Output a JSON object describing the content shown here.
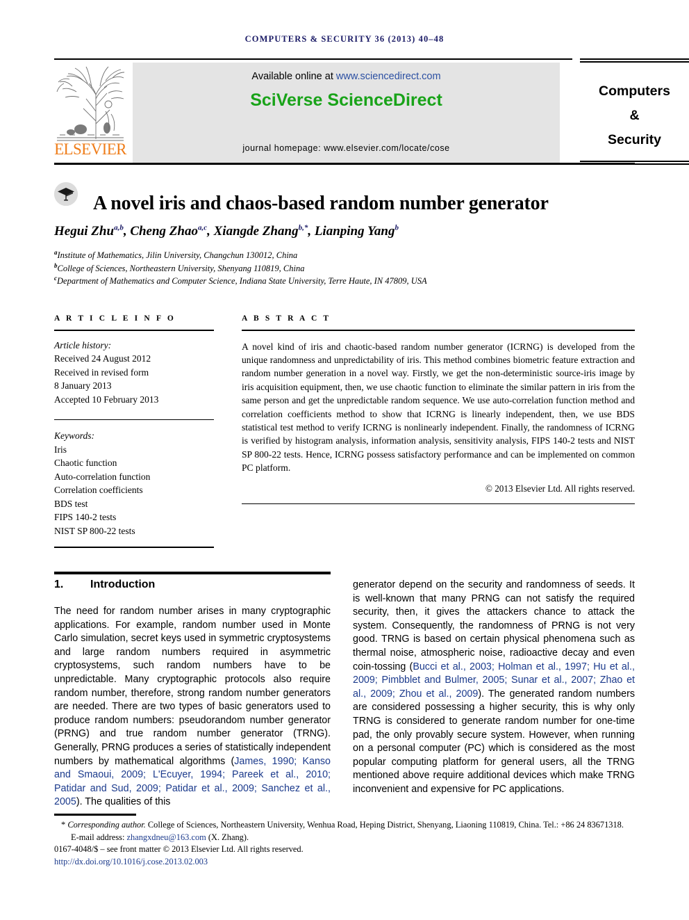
{
  "running_head": "COMPUTERS & SECURITY 36 (2013) 40–48",
  "masthead": {
    "available_prefix": "Available online at ",
    "available_url": "www.sciencedirect.com",
    "brand": "SciVerse ScienceDirect",
    "homepage": "journal homepage: www.elsevier.com/locate/cose",
    "publisher_logo_text": "ELSEVIER",
    "journal_name_lines": [
      "Computers",
      "&",
      "Security"
    ],
    "colors": {
      "panel_bg": "#e4e4e4",
      "brand_green": "#19a319",
      "link_blue": "#2b4fa2",
      "elsevier_orange": "#ef7d1a"
    }
  },
  "article": {
    "title": "A novel iris and chaos-based random number generator",
    "crossmark_icon": "graduation-cap-icon",
    "authors": [
      {
        "name": "Hegui Zhu",
        "sup": "a,b",
        "sep": ", "
      },
      {
        "name": "Cheng Zhao",
        "sup": "a,c",
        "sep": ", "
      },
      {
        "name": "Xiangde Zhang",
        "sup": "b,*",
        "sep": ", "
      },
      {
        "name": "Lianping Yang",
        "sup": "b",
        "sep": ""
      }
    ],
    "affiliations": [
      {
        "mark": "a",
        "text": "Institute of Mathematics, Jilin University, Changchun 130012, China"
      },
      {
        "mark": "b",
        "text": "College of Sciences, Northeastern University, Shenyang 110819, China"
      },
      {
        "mark": "c",
        "text": "Department of Mathematics and Computer Science, Indiana State University, Terre Haute, IN 47809, USA"
      }
    ]
  },
  "article_info": {
    "label": "A R T I C L E   I N F O",
    "history_head": "Article history:",
    "history_lines": [
      "Received 24 August 2012",
      "Received in revised form",
      "8 January 2013",
      "Accepted 10 February 2013"
    ],
    "keywords_head": "Keywords:",
    "keywords": [
      "Iris",
      "Chaotic function",
      "Auto-correlation function",
      "Correlation coefficients",
      "BDS test",
      "FIPS 140-2 tests",
      "NIST SP 800-22 tests"
    ]
  },
  "abstract": {
    "label": "A B S T R A C T",
    "text": "A novel kind of iris and chaotic-based random number generator (ICRNG) is developed from the unique randomness and unpredictability of iris. This method combines biometric feature extraction and random number generation in a novel way. Firstly, we get the non-deterministic source-iris image by iris acquisition equipment, then, we use chaotic function to eliminate the similar pattern in iris from the same person and get the unpredictable random sequence. We use auto-correlation function method and correlation coefficients method to show that ICRNG is linearly independent, then, we use BDS statistical test method to verify ICRNG is nonlinearly independent. Finally, the randomness of ICRNG is verified by histogram analysis, information analysis, sensitivity analysis, FIPS 140-2 tests and NIST SP 800-22 tests. Hence, ICRNG possess satisfactory performance and can be implemented on common PC platform.",
    "copyright": "© 2013 Elsevier Ltd. All rights reserved."
  },
  "section": {
    "number": "1.",
    "title": "Introduction",
    "left_paragraph_pre_cite": "The need for random number arises in many cryptographic applications. For example, random number used in Monte Carlo simulation, secret keys used in symmetric cryptosystems and large random numbers required in asymmetric cryptosystems, such random numbers have to be unpredictable. Many cryptographic protocols also require random number, therefore, strong random number generators are needed. There are two types of basic generators used to produce random numbers: pseudorandom number generator (PRNG) and true random number generator (TRNG). Generally, PRNG produces a series of statistically independent numbers by mathematical algorithms (",
    "left_citation": "James, 1990; Kanso and Smaoui, 2009; L'Ecuyer, 1994; Pareek et al., 2010; Patidar and Sud, 2009; Patidar et al., 2009; Sanchez et al., 2005",
    "left_paragraph_post_cite": "). The qualities of this",
    "right_paragraph_pre_cite": "generator depend on the security and randomness of seeds. It is well-known that many PRNG can not satisfy the required security, then, it gives the attackers chance to attack the system. Consequently, the randomness of PRNG is not very good. TRNG is based on certain physical phenomena such as thermal noise, atmospheric noise, radioactive decay and even coin-tossing (",
    "right_citation": "Bucci et al., 2003; Holman et al., 1997; Hu et al., 2009; Pimbblet and Bulmer, 2005; Sunar et al., 2007; Zhao et al., 2009; Zhou et al., 2009",
    "right_paragraph_post_cite": "). The generated random numbers are considered possessing a higher security, this is why only TRNG is considered to generate random number for one-time pad, the only provably secure system. However, when running on a personal computer (PC) which is considered as the most popular computing platform for general users, all the TRNG mentioned above require additional devices which make TRNG inconvenient and expensive for PC applications."
  },
  "footnotes": {
    "corresponding_marker": "*",
    "corresponding_label": "Corresponding author.",
    "corresponding_text": " College of Sciences, Northeastern University, Wenhua Road, Heping District, Shenyang, Liaoning 110819, China. Tel.: +86 24 83671318.",
    "email_label": "E-mail address: ",
    "email_address": "zhangxdneu@163.com",
    "email_suffix": " (X. Zhang).",
    "issn_line": "0167-4048/$ – see front matter © 2013 Elsevier Ltd. All rights reserved.",
    "doi": "http://dx.doi.org/10.1016/j.cose.2013.02.003"
  }
}
